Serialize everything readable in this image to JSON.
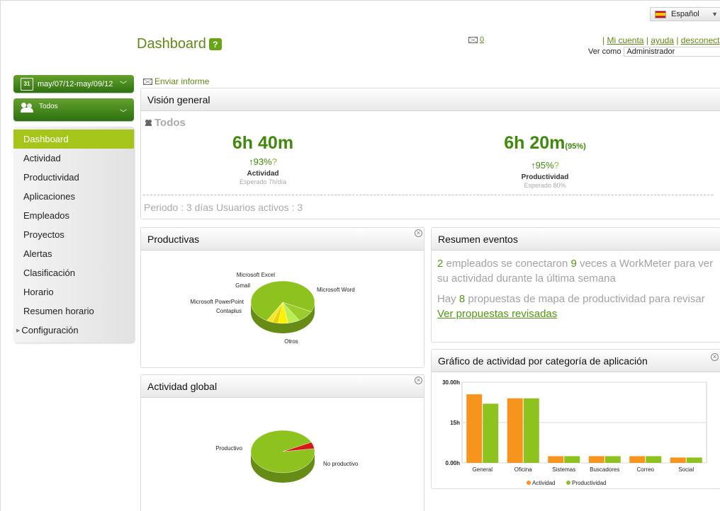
{
  "header": {
    "language": "Español",
    "title": "Dashboard",
    "help_badge": "?",
    "mail_count": "0",
    "links_prefix": "| ",
    "links": [
      "Mi cuenta",
      "ayuda",
      "desconect"
    ],
    "link_separator": " | ",
    "ver_como_label": "Ver como",
    "ver_como_value": "Administrador"
  },
  "sidebar": {
    "date_range": "may/07/12-may/09/12",
    "calendar_day": "31",
    "users_filter": "Todos",
    "nav": [
      {
        "label": "Dashboard",
        "active": true
      },
      {
        "label": "Actividad"
      },
      {
        "label": "Productividad"
      },
      {
        "label": "Aplicaciones"
      },
      {
        "label": "Empleados"
      },
      {
        "label": "Proyectos"
      },
      {
        "label": "Alertas"
      },
      {
        "label": "Clasificación"
      },
      {
        "label": "Horario"
      },
      {
        "label": "Resumen horario"
      },
      {
        "label": "Configuración",
        "expandable": true
      }
    ]
  },
  "main": {
    "send_report": "Enviar informe",
    "overview": {
      "title": "Visión general",
      "users": "Todos",
      "activity": {
        "value": "6h 40m",
        "arrow": "↑",
        "pct": "93%",
        "help": "?",
        "label": "Actividad",
        "expected": "Esperado 7h/día"
      },
      "productivity": {
        "value": "6h 20m",
        "value_suffix": "(95%)",
        "arrow": "↑",
        "pct": "95%",
        "help": "?",
        "label": "Productividad",
        "expected": "Esperado 80%"
      },
      "period_text": "Periodo : 3 días Usuarios activos : 3"
    },
    "productivas": {
      "title": "Productivas"
    },
    "actividad_global": {
      "title": "Actividad global"
    },
    "resumen": {
      "title": "Resumen eventos",
      "p1_n1": "2",
      "p1_a": " empleados se conectaron ",
      "p1_n2": "9",
      "p1_b": " veces a WorkMeter para ver su actividad durante la última semana",
      "p2_a": "Hay ",
      "p2_n": "8",
      "p2_b": " propuestas de mapa de productividad para revisar",
      "link": "Ver propuestas revisadas"
    },
    "grafico": {
      "title": "Gráfico de actividad por categoría de aplicación"
    }
  },
  "colors": {
    "brand_green": "#5f8a12",
    "nav_active": "#a6c51a",
    "orange": "#f7941d",
    "lime": "#8dc21f",
    "red": "#d7191c",
    "yellow": "#fff200"
  },
  "chart_data": [
    {
      "type": "pie",
      "labels": [
        "Otros",
        "Microsoft Word",
        "Microsoft Excel",
        "Gmail",
        "Microsoft PowerPoint",
        "Contaplus"
      ],
      "values": [
        74,
        9,
        6,
        5,
        3,
        3
      ]
    },
    {
      "type": "pie",
      "labels": [
        "Productivo",
        "No productivo"
      ],
      "values": [
        95,
        5
      ]
    },
    {
      "type": "bar",
      "categories": [
        "General",
        "Oficina",
        "Sistemas",
        "Buscadores",
        "Correo",
        "Social"
      ],
      "series": [
        {
          "name": "Actividad",
          "values": [
            25.5,
            24,
            2.5,
            2.5,
            2.5,
            2
          ]
        },
        {
          "name": "Productividad",
          "values": [
            22,
            24,
            2.5,
            2.5,
            2.5,
            2
          ]
        }
      ],
      "y_ticks": [
        "30.00h",
        "15h",
        "0.00h"
      ],
      "ylim": [
        0,
        30
      ],
      "legend": "bottom",
      "grid": true
    }
  ]
}
